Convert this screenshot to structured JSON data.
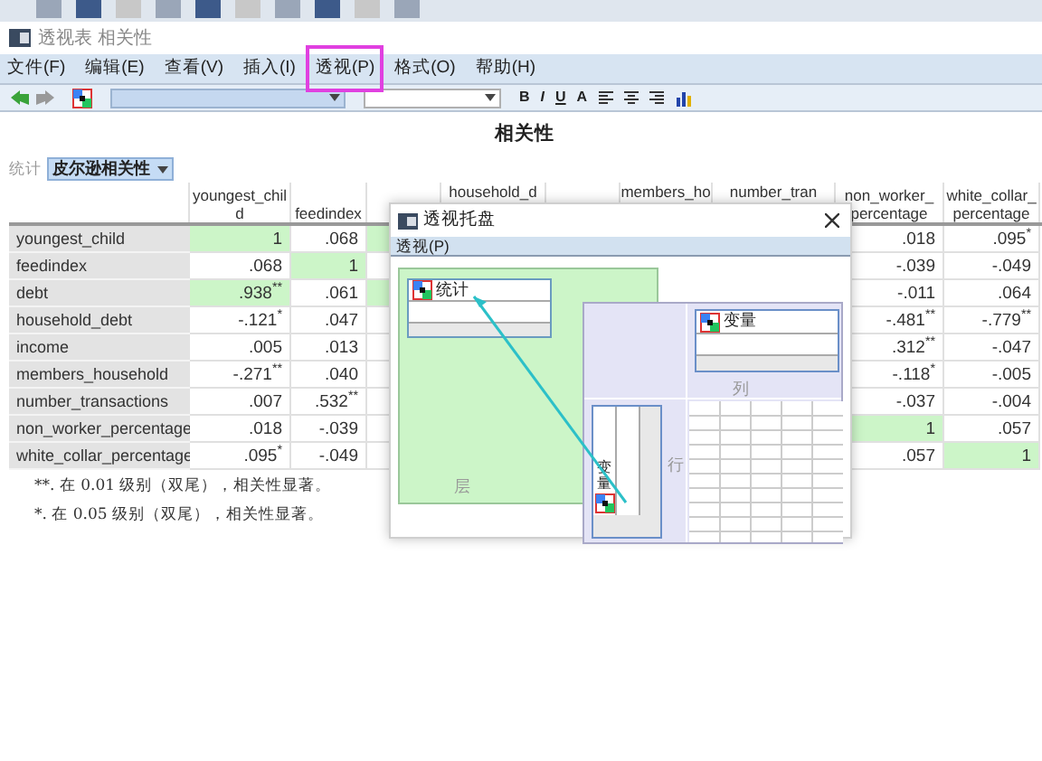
{
  "window": {
    "title": "透视表 相关性"
  },
  "menu": [
    {
      "label": "文件(F)",
      "highlighted": false
    },
    {
      "label": "编辑(E)",
      "highlighted": false
    },
    {
      "label": "查看(V)",
      "highlighted": false
    },
    {
      "label": "插入(I)",
      "highlighted": false
    },
    {
      "label": "透视(P)",
      "highlighted": true
    },
    {
      "label": "格式(O)",
      "highlighted": false
    },
    {
      "label": "帮助(H)",
      "highlighted": false
    }
  ],
  "toolbar": {
    "format_buttons": [
      "B",
      "I",
      "U",
      "A"
    ]
  },
  "report": {
    "title": "相关性",
    "layer_label": "统计",
    "layer_value": "皮尔逊相关性",
    "columns": [
      {
        "lines": [
          "youngest_chil",
          "d"
        ]
      },
      {
        "lines": [
          "feedindex"
        ]
      },
      {},
      {
        "lines": [
          "household_d"
        ]
      },
      {},
      {
        "lines": [
          "members_ho"
        ]
      },
      {
        "lines": [
          "number_tran"
        ]
      },
      {
        "lines": [
          "non_worker_",
          "percentage"
        ]
      },
      {
        "lines": [
          "white_collar_",
          "percentage"
        ]
      }
    ],
    "rows": [
      {
        "label": "youngest_child",
        "left": [
          {
            "text": "1",
            "highlighted": true
          },
          {
            "text": ".068",
            "highlighted": false
          },
          {
            "highlighted": true
          }
        ],
        "right": [
          {
            "text": ".018",
            "highlighted": false
          },
          {
            "text": ".095$^{*}$",
            "highlighted": false
          }
        ]
      },
      {
        "label": "feedindex",
        "left": [
          {
            "text": ".068",
            "highlighted": false
          },
          {
            "text": "1",
            "highlighted": true
          },
          {
            "highlighted": false
          }
        ],
        "right": [
          {
            "text": "-.039",
            "highlighted": false
          },
          {
            "text": "-.049",
            "highlighted": false
          }
        ]
      },
      {
        "label": "debt",
        "left": [
          {
            "text": ".938$^{**}$",
            "highlighted": true
          },
          {
            "text": ".061",
            "highlighted": false
          },
          {
            "highlighted": true
          }
        ],
        "right": [
          {
            "text": "-.011",
            "highlighted": false
          },
          {
            "text": ".064",
            "highlighted": false
          }
        ]
      },
      {
        "label": "household_debt",
        "left": [
          {
            "text": "-.121$^{*}$",
            "highlighted": false
          },
          {
            "text": ".047",
            "highlighted": false
          },
          {
            "highlighted": false
          }
        ],
        "right": [
          {
            "text": "-.481$^{**}$",
            "highlighted": false
          },
          {
            "text": "-.779$^{**}$",
            "highlighted": false
          }
        ]
      },
      {
        "label": "income",
        "left": [
          {
            "text": ".005",
            "highlighted": false
          },
          {
            "text": ".013",
            "highlighted": false
          },
          {
            "highlighted": false
          }
        ],
        "right": [
          {
            "text": ".312$^{**}$",
            "highlighted": false
          },
          {
            "text": "-.047",
            "highlighted": false
          }
        ]
      },
      {
        "label": "members_household",
        "left": [
          {
            "text": "-.271$^{**}$",
            "highlighted": false
          },
          {
            "text": ".040",
            "highlighted": false
          },
          {
            "highlighted": false
          }
        ],
        "right": [
          {
            "text": "-.118$^{*}$",
            "highlighted": false
          },
          {
            "text": "-.005",
            "highlighted": false
          }
        ]
      },
      {
        "label": "number_transactions",
        "left": [
          {
            "text": ".007",
            "highlighted": false
          },
          {
            "text": ".532$^{**}$",
            "highlighted": false
          },
          {
            "highlighted": false
          }
        ],
        "right": [
          {
            "text": "-.037",
            "highlighted": false
          },
          {
            "text": "-.004",
            "highlighted": false
          }
        ]
      },
      {
        "label": "non_worker_percentage",
        "left": [
          {
            "text": ".018",
            "highlighted": false
          },
          {
            "text": "-.039",
            "highlighted": false
          },
          {
            "highlighted": false
          }
        ],
        "right": [
          {
            "text": "1",
            "highlighted": true
          },
          {
            "text": ".057",
            "highlighted": false
          }
        ]
      },
      {
        "label": "white_collar_percentage",
        "left": [
          {
            "text": ".095$^{*}$",
            "highlighted": false
          },
          {
            "text": "-.049",
            "highlighted": false
          },
          {
            "highlighted": false
          }
        ],
        "right": [
          {
            "text": ".057",
            "highlighted": false
          },
          {
            "text": "1",
            "highlighted": true
          }
        ]
      }
    ],
    "footnotes": [
      "**. 在 0.01 级别（双尾），相关性显著。",
      "*. 在 0.05 级别（双尾），相关性显著。"
    ]
  },
  "pivot_dialog": {
    "title": "透视托盘",
    "menu": "透视(P)",
    "layer_item": "统计",
    "layer_label": "层",
    "column_item": "变量",
    "column_label": "列",
    "row_item": "变量",
    "row_label": "行"
  }
}
